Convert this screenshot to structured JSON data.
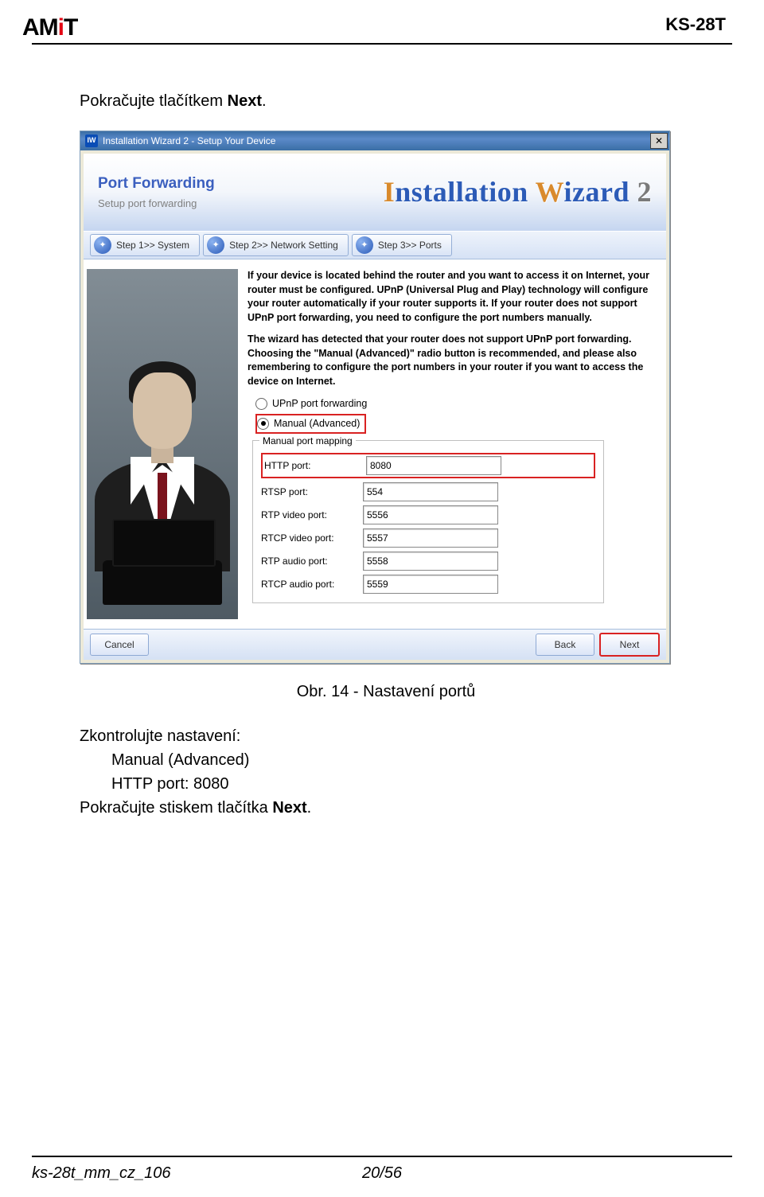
{
  "header": {
    "doc_id": "KS-28T"
  },
  "body": {
    "intro_text": "Pokračujte tlačítkem ",
    "intro_bold": "Next",
    "intro_end": "."
  },
  "wizard": {
    "title": "Installation Wizard 2 - Setup Your Device",
    "banner": {
      "title": "Port Forwarding",
      "subtitle": "Setup port forwarding",
      "product": "Installation Wizard 2"
    },
    "steps": {
      "s1": "Step 1>> System",
      "s2": "Step 2>> Network Setting",
      "s3": "Step 3>> Ports"
    },
    "para1": "If your device is located behind the router and you want to access it on Internet, your router must be configured. UPnP (Universal Plug and Play) technology will configure your router automatically if your router supports it. If your router does not support UPnP port forwarding, you need to configure the port numbers manually.",
    "para2": "The wizard has detected that your router does not support UPnP port forwarding. Choosing the \"Manual (Advanced)\" radio button is recommended, and please also remembering to configure the port numbers in your router if you want to access the device on Internet.",
    "radio_upnp": "UPnP port forwarding",
    "radio_manual": "Manual (Advanced)",
    "fieldset_legend": "Manual port mapping",
    "ports": {
      "http": {
        "label": "HTTP port:",
        "value": "8080"
      },
      "rtsp": {
        "label": "RTSP port:",
        "value": "554"
      },
      "rtpv": {
        "label": "RTP video port:",
        "value": "5556"
      },
      "rtcpv": {
        "label": "RTCP video port:",
        "value": "5557"
      },
      "rtpa": {
        "label": "RTP audio port:",
        "value": "5558"
      },
      "rtcpa": {
        "label": "RTCP audio port:",
        "value": "5559"
      }
    },
    "buttons": {
      "cancel": "Cancel",
      "back": "Back",
      "next": "Next"
    }
  },
  "caption": "Obr. 14 - Nastavení portů",
  "check": {
    "line1": "Zkontrolujte nastavení:",
    "line2": "Manual (Advanced)",
    "line3_a": "HTTP port: ",
    "line3_b": "8080",
    "line4_a": "Pokračujte stiskem tlačítka ",
    "line4_b": "Next",
    "line4_c": "."
  },
  "footer": {
    "file": "ks-28t_mm_cz_106",
    "page": "20/56"
  }
}
